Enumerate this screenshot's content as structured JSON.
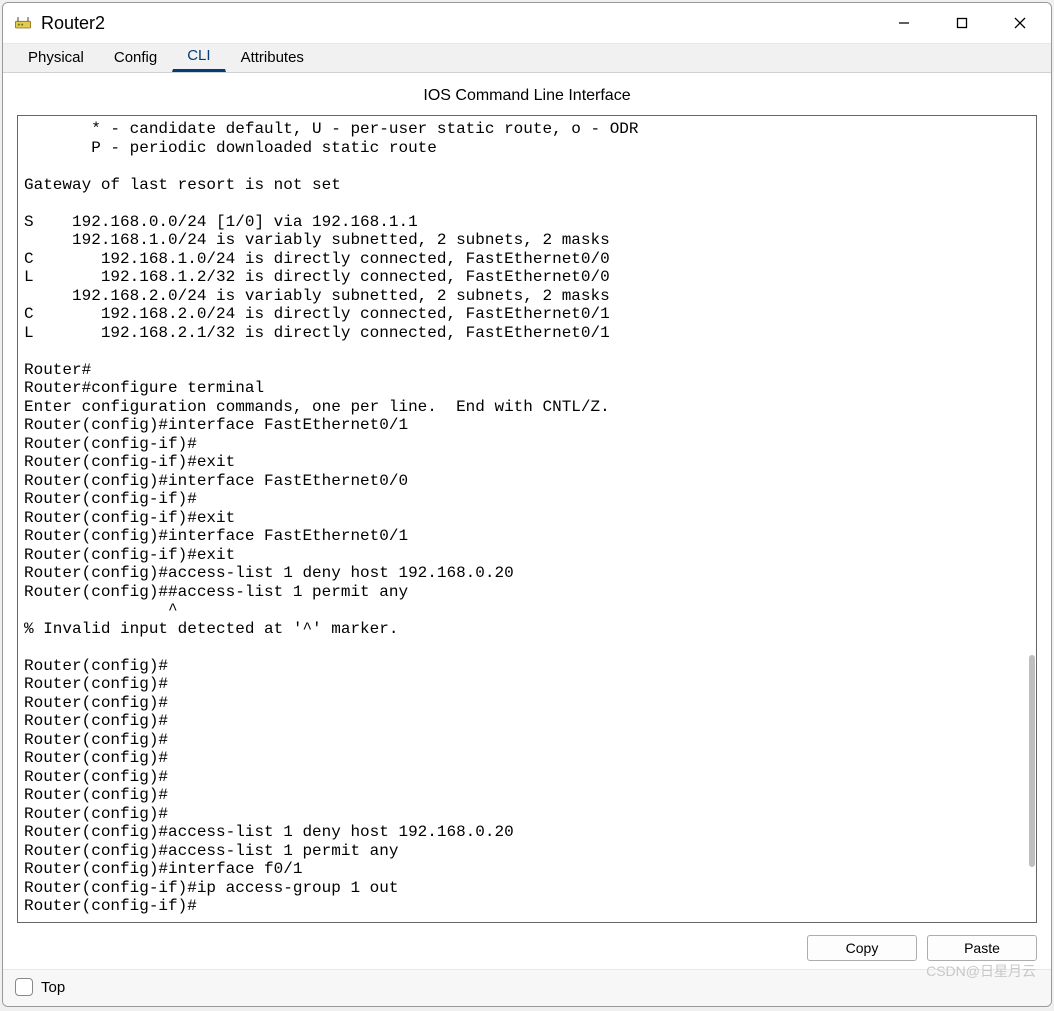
{
  "window": {
    "title": "Router2"
  },
  "tabs": {
    "items": [
      {
        "label": "Physical"
      },
      {
        "label": "Config"
      },
      {
        "label": "CLI"
      },
      {
        "label": "Attributes"
      }
    ],
    "active_index": 2
  },
  "subtitle": "IOS Command Line Interface",
  "terminal_text": "       * - candidate default, U - per-user static route, o - ODR\n       P - periodic downloaded static route\n\nGateway of last resort is not set\n\nS    192.168.0.0/24 [1/0] via 192.168.1.1\n     192.168.1.0/24 is variably subnetted, 2 subnets, 2 masks\nC       192.168.1.0/24 is directly connected, FastEthernet0/0\nL       192.168.1.2/32 is directly connected, FastEthernet0/0\n     192.168.2.0/24 is variably subnetted, 2 subnets, 2 masks\nC       192.168.2.0/24 is directly connected, FastEthernet0/1\nL       192.168.2.1/32 is directly connected, FastEthernet0/1\n\nRouter#\nRouter#configure terminal\nEnter configuration commands, one per line.  End with CNTL/Z.\nRouter(config)#interface FastEthernet0/1\nRouter(config-if)#\nRouter(config-if)#exit\nRouter(config)#interface FastEthernet0/0\nRouter(config-if)#\nRouter(config-if)#exit\nRouter(config)#interface FastEthernet0/1\nRouter(config-if)#exit\nRouter(config)#access-list 1 deny host 192.168.0.20\nRouter(config)##access-list 1 permit any\n               ^\n% Invalid input detected at '^' marker.\n\nRouter(config)#\nRouter(config)#\nRouter(config)#\nRouter(config)#\nRouter(config)#\nRouter(config)#\nRouter(config)#\nRouter(config)#\nRouter(config)#\nRouter(config)#access-list 1 deny host 192.168.0.20\nRouter(config)#access-list 1 permit any\nRouter(config)#interface f0/1\nRouter(config-if)#ip access-group 1 out\nRouter(config-if)#",
  "buttons": {
    "copy": "Copy",
    "paste": "Paste"
  },
  "bottom": {
    "top_label": "Top"
  },
  "watermark": "CSDN@日星月云"
}
